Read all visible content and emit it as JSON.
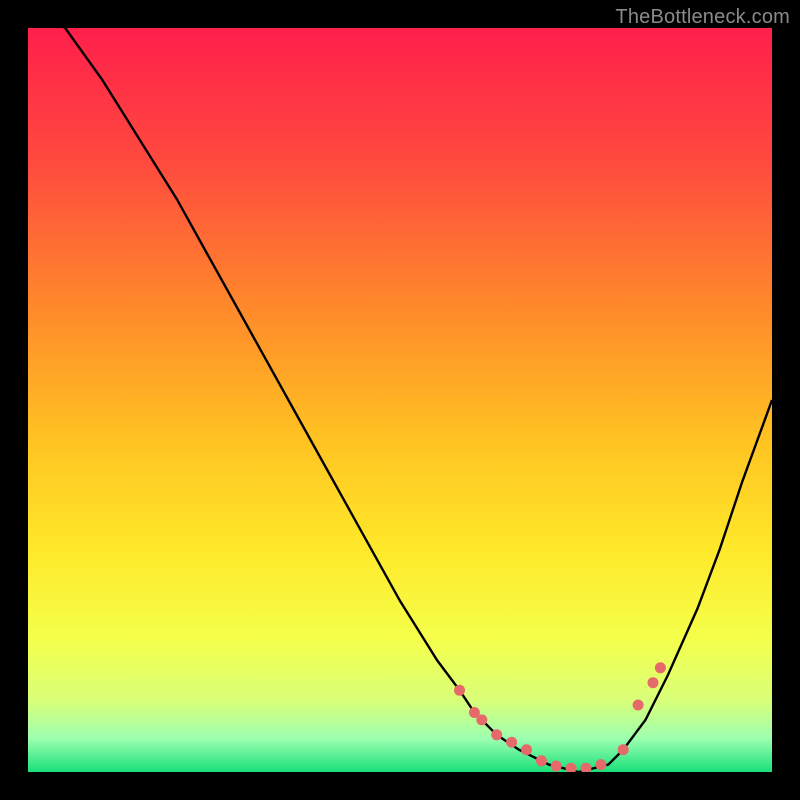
{
  "header": {
    "watermark": "TheBottleneck.com"
  },
  "chart_data": {
    "type": "line",
    "title": "",
    "xlabel": "",
    "ylabel": "",
    "xlim": [
      0,
      100
    ],
    "ylim": [
      0,
      100
    ],
    "x": [
      0,
      5,
      10,
      15,
      20,
      25,
      30,
      35,
      40,
      45,
      50,
      55,
      58,
      60,
      63,
      66,
      70,
      74,
      78,
      80,
      83,
      86,
      90,
      93,
      96,
      100
    ],
    "values": [
      103,
      100,
      93,
      85,
      77,
      68,
      59,
      50,
      41,
      32,
      23,
      15,
      11,
      8,
      5,
      3,
      1,
      0,
      1,
      3,
      7,
      13,
      22,
      30,
      39,
      50
    ],
    "points": {
      "note": "approximate (x,bottleneck%) positions of the highlighted pink/red markers",
      "x": [
        58,
        60,
        61,
        63,
        65,
        67,
        69,
        71,
        73,
        75,
        77,
        80,
        82,
        84,
        85
      ],
      "y": [
        11,
        8,
        7,
        5,
        4,
        3,
        1.5,
        0.8,
        0.5,
        0.5,
        1,
        3,
        9,
        12,
        14
      ],
      "color": "#e76a6a",
      "radius": 5.5
    },
    "curve_color": "#000000",
    "background_gradient": {
      "stops": [
        {
          "pos": 0.0,
          "color": "#ff1f4b"
        },
        {
          "pos": 0.18,
          "color": "#ff4a3f"
        },
        {
          "pos": 0.38,
          "color": "#ff8a2a"
        },
        {
          "pos": 0.55,
          "color": "#ffc222"
        },
        {
          "pos": 0.7,
          "color": "#ffe82a"
        },
        {
          "pos": 0.82,
          "color": "#f5ff4a"
        },
        {
          "pos": 0.905,
          "color": "#d8ff7a"
        },
        {
          "pos": 0.955,
          "color": "#9dffb0"
        },
        {
          "pos": 1.0,
          "color": "#18e07a"
        }
      ]
    }
  }
}
